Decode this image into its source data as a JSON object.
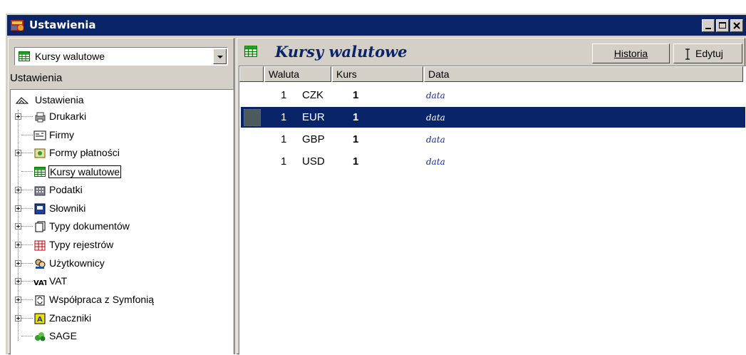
{
  "window": {
    "title": "Ustawienia"
  },
  "left": {
    "combo_value": "Kursy walutowe",
    "section_label": "Ustawienia",
    "tree": {
      "root": "Ustawienia",
      "items": [
        {
          "label": "Drukarki",
          "icon": "printer-icon",
          "expand": true
        },
        {
          "label": "Firmy",
          "icon": "company-card-icon",
          "expand": false
        },
        {
          "label": "Formy płatności",
          "icon": "payment-icon",
          "expand": true
        },
        {
          "label": "Kursy walutowe",
          "icon": "grid-table-icon",
          "expand": false,
          "selected": true
        },
        {
          "label": "Podatki",
          "icon": "tax-building-icon",
          "expand": true
        },
        {
          "label": "Słowniki",
          "icon": "dictionary-icon",
          "expand": true
        },
        {
          "label": "Typy dokumentów",
          "icon": "documents-icon",
          "expand": true
        },
        {
          "label": "Typy rejestrów",
          "icon": "register-icon",
          "expand": true
        },
        {
          "label": "Użytkownicy",
          "icon": "users-icon",
          "expand": true
        },
        {
          "label": "VAT",
          "icon": "vat-icon",
          "expand": true
        },
        {
          "label": "Współpraca z Symfonią",
          "icon": "sync-icon",
          "expand": true
        },
        {
          "label": "Znaczniki",
          "icon": "marker-icon",
          "expand": true
        },
        {
          "label": "SAGE",
          "icon": "sage-logo-icon",
          "expand": false
        }
      ]
    }
  },
  "right": {
    "title": "Kursy walutowe",
    "buttons": {
      "history": "Historia",
      "edit": "Edytuj"
    },
    "columns": [
      "Waluta",
      "Kurs",
      "Data"
    ],
    "rows": [
      {
        "num": "1",
        "code": "CZK",
        "rate": "1",
        "date": "data"
      },
      {
        "num": "1",
        "code": "EUR",
        "rate": "1",
        "date": "data"
      },
      {
        "num": "1",
        "code": "GBP",
        "rate": "1",
        "date": "data"
      },
      {
        "num": "1",
        "code": "USD",
        "rate": "1",
        "date": "data"
      }
    ],
    "selected_row": 1
  },
  "colors": {
    "titlebar": "#0a246a",
    "face": "#d4d0c8",
    "selection": "#0a246a"
  }
}
